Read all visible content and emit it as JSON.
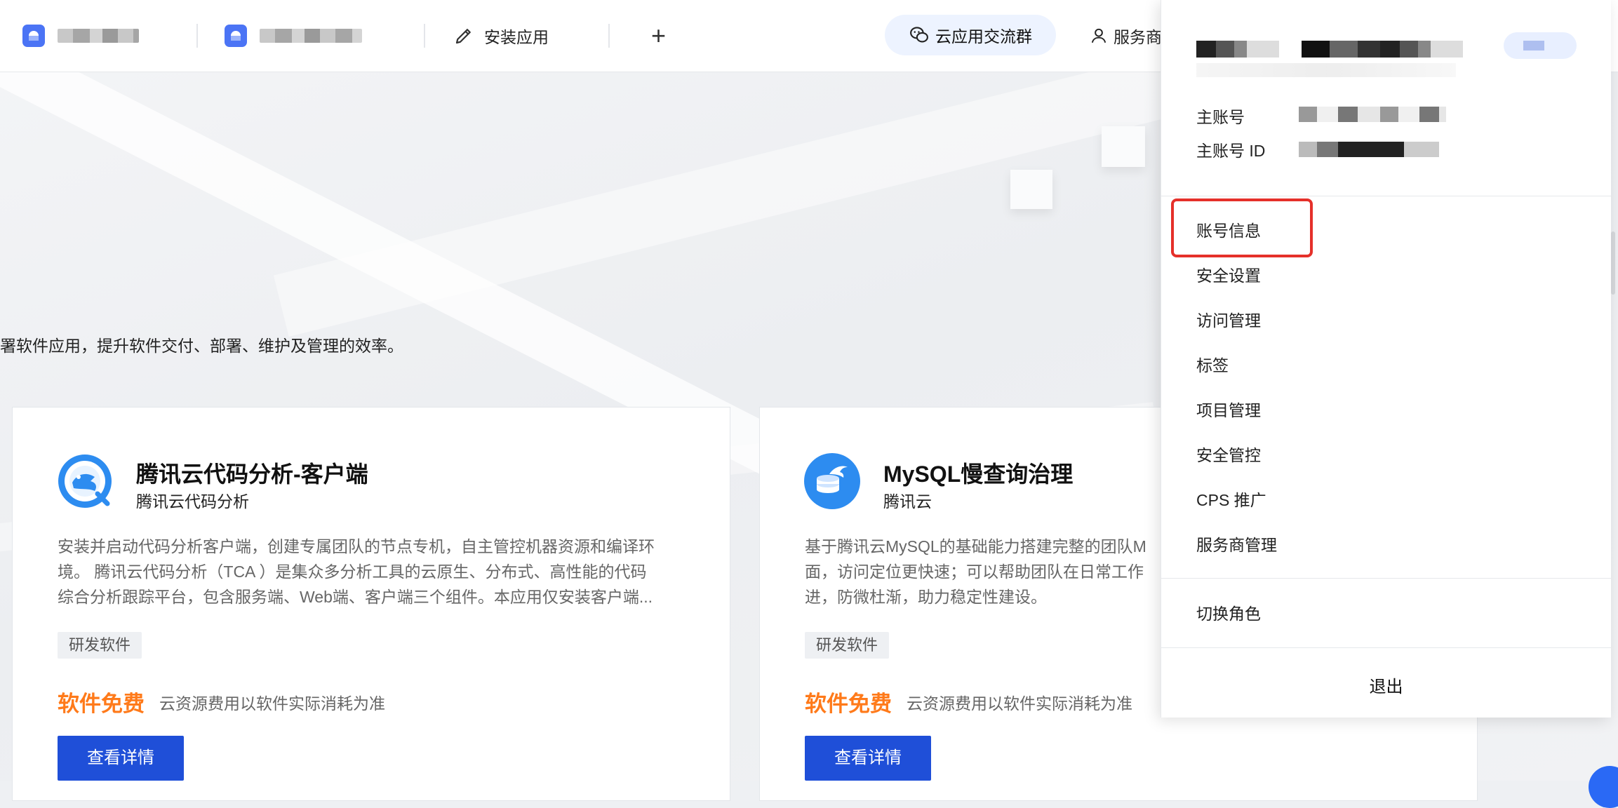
{
  "topbar": {
    "app1_name_redacted": "",
    "app2_name_redacted": "",
    "install_label": "安装应用",
    "add_label": "+",
    "wechat_group_label": "云应用交流群",
    "service_label": "服务商"
  },
  "hero": {
    "description": "署软件应用，提升软件交付、部署、维护及管理的效率。"
  },
  "cards": [
    {
      "title": "腾讯云代码分析-客户端",
      "vendor": "腾讯云代码分析",
      "desc_lines": [
        "安装并启动代码分析客户端，创建专属团队的节点专机，自主管控机器资源和编译环",
        "境。 腾讯云代码分析（TCA ）是集众多分析工具的云原生、分布式、高性能的代码",
        "综合分析跟踪平台，包含服务端、Web端、客户端三个组件。本应用仅安装客户端..."
      ],
      "tag": "研发软件",
      "price": "软件免费",
      "price_note": "云资源费用以软件实际消耗为准",
      "button": "查看详情"
    },
    {
      "title": "MySQL慢查询治理",
      "vendor": "腾讯云",
      "desc_lines": [
        "基于腾讯云MySQL的基础能力搭建完整的团队M",
        "面，访问定位更快速；可以帮助团队在日常工作",
        "进，防微杜渐，助力稳定性建设。"
      ],
      "tag": "研发软件",
      "price": "软件免费",
      "price_note": "云资源费用以软件实际消耗为准",
      "button": "查看详情"
    }
  ],
  "dropdown": {
    "main_account_label": "主账号",
    "main_account_id_label": "主账号 ID",
    "menu": [
      "账号信息",
      "安全设置",
      "访问管理",
      "标签",
      "项目管理",
      "安全管控",
      "CPS 推广",
      "服务商管理"
    ],
    "switch_role": "切换角色",
    "logout": "退出"
  },
  "colors": {
    "primary_button": "#1f4fd8",
    "price_orange": "#ff7a1a",
    "highlight_red": "#e5302a"
  }
}
